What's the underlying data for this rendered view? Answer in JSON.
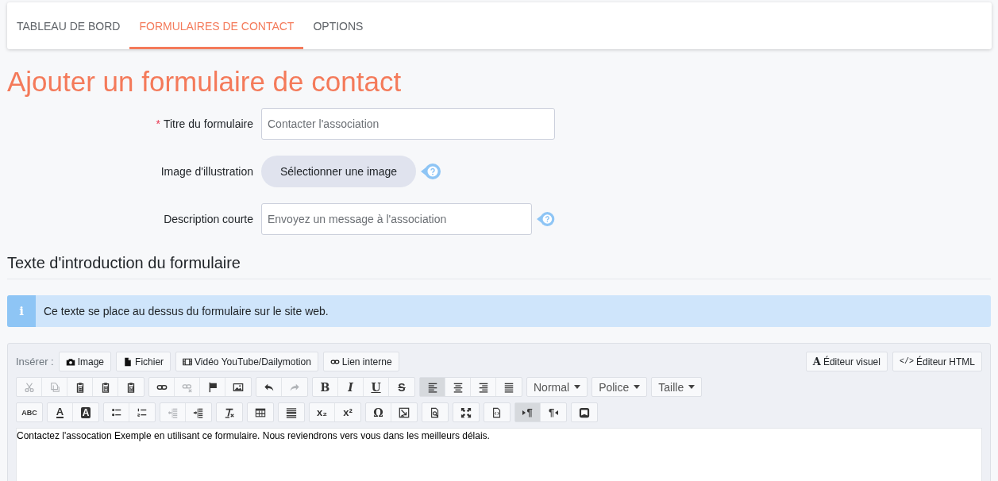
{
  "tabs": [
    {
      "label": "TABLEAU DE BORD",
      "selected": false
    },
    {
      "label": "FORMULAIRES DE CONTACT",
      "selected": true
    },
    {
      "label": "OPTIONS",
      "selected": false
    }
  ],
  "page_title": "Ajouter un formulaire de contact",
  "form_fields": [
    {
      "kind": "input",
      "label": "Titre du formulaire",
      "required": true,
      "placeholder": "Contacter l'association",
      "help": false
    },
    {
      "kind": "image",
      "label": "Image d'illustration",
      "required": false,
      "button": "Sélectionner une image",
      "help": true
    },
    {
      "kind": "input",
      "label": "Description courte",
      "required": false,
      "placeholder": "Envoyez un message à l'association",
      "help": true
    }
  ],
  "required_mark": "*",
  "section_title": "Texte d'introduction du formulaire",
  "info": {
    "icon": "i",
    "text": "Ce texte se place au dessus du formulaire sur le site web."
  },
  "editor": {
    "insert_label": "Insérer :",
    "insert_buttons": [
      {
        "kind": "camera",
        "label": "Image"
      },
      {
        "kind": "file",
        "label": "Fichier"
      },
      {
        "kind": "film",
        "label": "Vidéo YouTube/Dailymotion"
      },
      {
        "kind": "chain",
        "label": "Lien interne"
      }
    ],
    "mode_buttons": [
      {
        "glyph": "A",
        "label": "Éditeur visuel"
      },
      {
        "glyph": "</>",
        "label": "Éditeur HTML"
      }
    ],
    "toolbar_rows": [
      [
        [
          {
            "kind": "cut",
            "disabled": true,
            "active": false
          },
          {
            "kind": "copy",
            "disabled": true,
            "active": false
          },
          {
            "kind": "paste",
            "disabled": false,
            "active": false
          },
          {
            "kind": "paste-text",
            "disabled": false,
            "active": false
          },
          {
            "kind": "paste-word",
            "disabled": false,
            "active": false
          }
        ],
        [
          {
            "kind": "link",
            "disabled": false,
            "active": false
          },
          {
            "kind": "unlink",
            "disabled": true,
            "active": false
          },
          {
            "kind": "flag",
            "disabled": false,
            "active": false
          },
          {
            "kind": "image",
            "disabled": false,
            "active": false
          }
        ],
        [
          {
            "kind": "undo",
            "disabled": false,
            "active": false
          },
          {
            "kind": "redo",
            "disabled": true,
            "active": false
          }
        ],
        [
          {
            "kind": "bold",
            "glyph": "B",
            "disabled": false,
            "active": false
          },
          {
            "kind": "italic",
            "glyph": "I",
            "disabled": false,
            "active": false
          },
          {
            "kind": "underline",
            "glyph": "U",
            "disabled": false,
            "active": false
          },
          {
            "kind": "strike",
            "glyph": "S",
            "disabled": false,
            "active": false
          }
        ],
        [
          {
            "kind": "align-left",
            "disabled": false,
            "active": true
          },
          {
            "kind": "align-center",
            "disabled": false,
            "active": false
          },
          {
            "kind": "align-right",
            "disabled": false,
            "active": false
          },
          {
            "kind": "justify",
            "disabled": false,
            "active": false
          }
        ],
        [
          {
            "kind": "dropdown",
            "label": "Normal"
          }
        ],
        [
          {
            "kind": "dropdown",
            "label": "Police"
          }
        ],
        [
          {
            "kind": "dropdown",
            "label": "Taille"
          }
        ]
      ],
      [
        [
          {
            "kind": "spellcheck",
            "glyph": "ABC",
            "disabled": false,
            "active": false
          }
        ],
        [
          {
            "kind": "text-color",
            "glyph": "A",
            "disabled": false,
            "active": false
          },
          {
            "kind": "bg-color",
            "glyph": "A",
            "disabled": false,
            "active": false
          }
        ],
        [
          {
            "kind": "bullets",
            "disabled": false,
            "active": false
          },
          {
            "kind": "numbers",
            "disabled": false,
            "active": false
          }
        ],
        [
          {
            "kind": "outdent",
            "disabled": true,
            "active": false
          },
          {
            "kind": "indent",
            "disabled": false,
            "active": false
          }
        ],
        [
          {
            "kind": "clear-format",
            "disabled": false,
            "active": false
          }
        ],
        [
          {
            "kind": "table",
            "disabled": false,
            "active": false
          }
        ],
        [
          {
            "kind": "hr",
            "disabled": false,
            "active": false
          }
        ],
        [
          {
            "kind": "subscript",
            "glyph": "x₂",
            "disabled": false,
            "active": false
          },
          {
            "kind": "superscript",
            "glyph": "x²",
            "disabled": false,
            "active": false
          }
        ],
        [
          {
            "kind": "symbol",
            "glyph": "Ω",
            "disabled": false,
            "active": false
          },
          {
            "kind": "image-arrow",
            "disabled": false,
            "active": false
          }
        ],
        [
          {
            "kind": "preview",
            "disabled": false,
            "active": false
          }
        ],
        [
          {
            "kind": "maximize",
            "disabled": false,
            "active": false
          }
        ],
        [
          {
            "kind": "source",
            "disabled": false,
            "active": false
          }
        ],
        [
          {
            "kind": "ltr",
            "glyph": "¶",
            "disabled": false,
            "active": true
          },
          {
            "kind": "rtl",
            "glyph": "¶",
            "disabled": false,
            "active": false
          }
        ],
        [
          {
            "kind": "frame",
            "disabled": false,
            "active": false
          }
        ]
      ]
    ],
    "content": "Contactez l'assocation Exemple en utilisant ce formulaire. Nous reviendrons vers vous dans les meilleurs délais."
  }
}
